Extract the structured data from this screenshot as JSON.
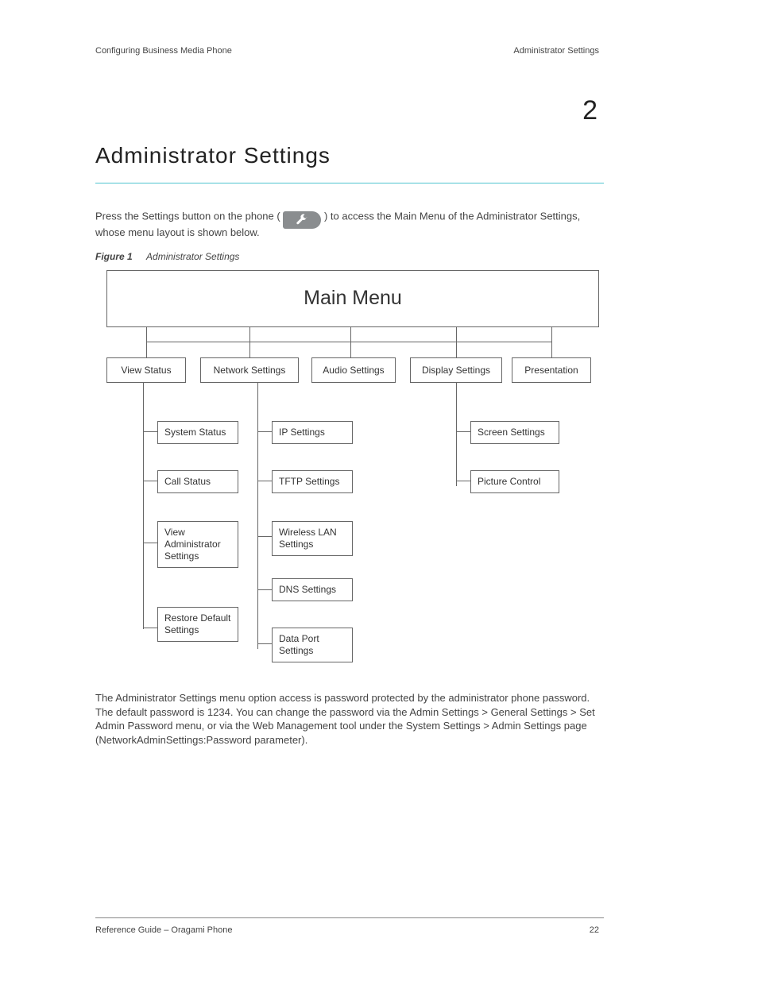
{
  "header": {
    "left": "Configuring Business Media Phone",
    "right": "Administrator Settings"
  },
  "chapter": {
    "number": "2",
    "title": "Administrator Settings"
  },
  "intro": {
    "prefix": "Press the Settings button on the phone (",
    "suffix": ") to access the Main Menu of the Administrator Settings, whose menu layout is shown below."
  },
  "figure": {
    "label": "Figure 1",
    "title": "Administrator Settings"
  },
  "diagram": {
    "main": "Main Menu",
    "categories": [
      {
        "name": "View Status",
        "children": [
          "System Status",
          "Call Status",
          "View Administrator Settings",
          "Restore Default Settings"
        ]
      },
      {
        "name": "Network Settings",
        "children": [
          "IP Settings",
          "TFTP Settings",
          "Wireless LAN Settings",
          "DNS Settings",
          "Data Port Settings"
        ]
      },
      {
        "name": "Audio Settings",
        "children": []
      },
      {
        "name": "Display Settings",
        "children": [
          "Screen Settings",
          "Picture Control"
        ]
      },
      {
        "name": "Presentation",
        "children": []
      }
    ]
  },
  "footnote": "The Administrator Settings menu option access is password protected by the administrator phone password. The default password is 1234. You can change the password via the Admin Settings > General Settings > Set Admin Password menu, or via the Web Management tool under the System Settings > Admin Settings page (NetworkAdminSettings:Password parameter).",
  "footer": {
    "left": "Reference Guide – Oragami Phone",
    "right": "22"
  }
}
